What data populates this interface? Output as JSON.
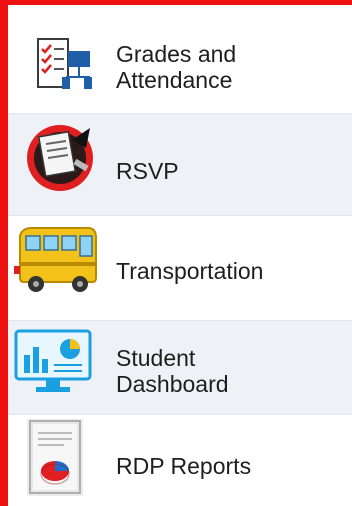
{
  "menu": {
    "items": [
      {
        "label": "Grades and Attendance",
        "icon": "checklist-org-chart-icon"
      },
      {
        "label": "RSVP",
        "icon": "rsvp-invitation-icon"
      },
      {
        "label": "Transportation",
        "icon": "school-bus-icon"
      },
      {
        "label": "Student Dashboard",
        "icon": "dashboard-monitor-icon"
      },
      {
        "label": "RDP Reports",
        "icon": "report-pie-chart-icon"
      }
    ]
  },
  "colors": {
    "frame": "#ee1111",
    "item_alt_bg": "#eef2f7",
    "text": "#1e1e1e",
    "accent_blue": "#1f5fa8"
  }
}
